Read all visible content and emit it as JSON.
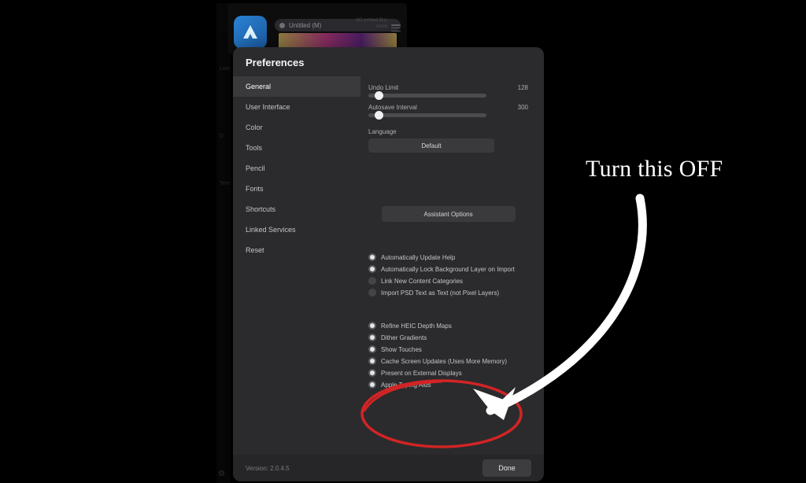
{
  "background": {
    "document_tab": "Untitled (M)",
    "tab_info_line1": "AD embed Bus",
    "tab_info_line2": "mock",
    "rail_labels": [
      "Live",
      "D",
      "Tem"
    ]
  },
  "modal": {
    "title": "Preferences",
    "sidebar": {
      "items": [
        {
          "label": "General",
          "selected": true
        },
        {
          "label": "User Interface",
          "selected": false
        },
        {
          "label": "Color",
          "selected": false
        },
        {
          "label": "Tools",
          "selected": false
        },
        {
          "label": "Pencil",
          "selected": false
        },
        {
          "label": "Fonts",
          "selected": false
        },
        {
          "label": "Shortcuts",
          "selected": false
        },
        {
          "label": "Linked Services",
          "selected": false
        },
        {
          "label": "Reset",
          "selected": false
        }
      ]
    },
    "pane": {
      "undo_label": "Undo Limit",
      "undo_value": "128",
      "autosave_label": "Autosave Interval",
      "autosave_value": "300",
      "language_label": "Language",
      "language_value": "Default",
      "assistant_button": "Assistant Options",
      "checks": [
        {
          "label": "Automatically Update Help",
          "state": "on"
        },
        {
          "label": "Automatically Lock Background Layer on Import",
          "state": "on"
        },
        {
          "label": "Link New Content Categories",
          "state": "dim"
        },
        {
          "label": "Import PSD Text as Text (not Pixel Layers)",
          "state": "dim"
        },
        {
          "label": "Refine HEIC Depth Maps",
          "state": "on"
        },
        {
          "label": "Dither Gradients",
          "state": "on"
        },
        {
          "label": "Show Touches",
          "state": "on"
        },
        {
          "label": "Cache Screen Updates (Uses More Memory)",
          "state": "on"
        },
        {
          "label": "Present on External Displays",
          "state": "on"
        },
        {
          "label": "Apple Typing Aids",
          "state": "on"
        }
      ]
    },
    "version": "Version: 2.0.4.5",
    "done": "Done"
  },
  "annotation": {
    "text": "Turn this OFF",
    "oval_color": "#d22424",
    "arrow_color": "#ffffff"
  }
}
